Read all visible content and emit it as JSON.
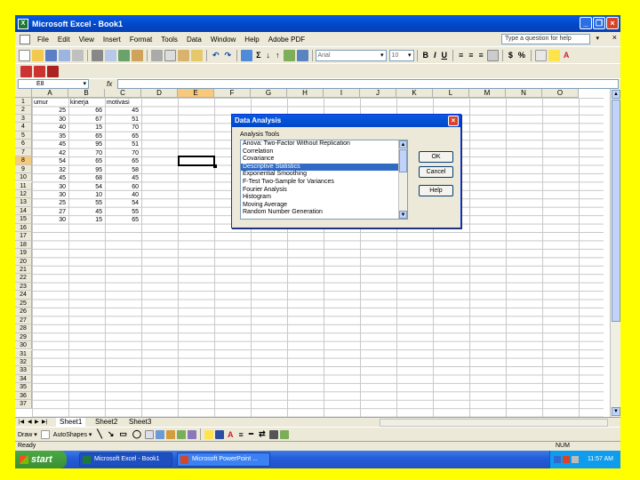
{
  "window": {
    "title": "Microsoft Excel - Book1",
    "app_icon": "X"
  },
  "menubar": {
    "items": [
      "File",
      "Edit",
      "View",
      "Insert",
      "Format",
      "Tools",
      "Data",
      "Window",
      "Help",
      "Adobe PDF"
    ],
    "help_placeholder": "Type a question for help",
    "doc_close": "× "
  },
  "toolbar": {
    "font_name": "Arial",
    "font_size": "10",
    "bold": "B",
    "italic": "I",
    "underline": "U",
    "currency": "$",
    "percent": "%"
  },
  "formula_bar": {
    "name_box": "E8",
    "fx": "fx"
  },
  "grid": {
    "columns": [
      "A",
      "B",
      "C",
      "D",
      "E",
      "F",
      "G",
      "H",
      "I",
      "J",
      "K",
      "L",
      "M",
      "N",
      "O"
    ],
    "rows": [
      "1",
      "2",
      "3",
      "4",
      "5",
      "6",
      "7",
      "8",
      "9",
      "10",
      "11",
      "12",
      "13",
      "14",
      "15",
      "16",
      "17",
      "18",
      "19",
      "20",
      "21",
      "22",
      "23",
      "24",
      "25",
      "26",
      "27",
      "28",
      "29",
      "30",
      "31",
      "32",
      "33",
      "34",
      "35",
      "36",
      "37"
    ],
    "active_cell": "E8",
    "headers": [
      "umur",
      "kinerja",
      "motivasi"
    ],
    "data": [
      [
        "25",
        "66",
        "45"
      ],
      [
        "30",
        "67",
        "51"
      ],
      [
        "40",
        "15",
        "70"
      ],
      [
        "35",
        "65",
        "65"
      ],
      [
        "45",
        "95",
        "51"
      ],
      [
        "42",
        "70",
        "70"
      ],
      [
        "54",
        "65",
        "65"
      ],
      [
        "32",
        "95",
        "58"
      ],
      [
        "45",
        "68",
        "45"
      ],
      [
        "30",
        "54",
        "60"
      ],
      [
        "30",
        "10",
        "40"
      ],
      [
        "25",
        "55",
        "54"
      ],
      [
        "27",
        "45",
        "55"
      ],
      [
        "30",
        "15",
        "65"
      ]
    ]
  },
  "sheets": {
    "tabs": [
      "Sheet1",
      "Sheet2",
      "Sheet3"
    ],
    "active": "Sheet1"
  },
  "drawbar": {
    "draw_label": "Draw ▾",
    "autoshapes_label": "AutoShapes ▾"
  },
  "status": {
    "left": "Ready",
    "num": "NUM"
  },
  "taskbar": {
    "start": "start",
    "items": [
      "Microsoft Excel - Book1",
      "Microsoft PowerPoint ..."
    ],
    "clock": "11:57 AM"
  },
  "dialog": {
    "title": "Data Analysis",
    "tools_label": "Analysis Tools",
    "tools": [
      "Anova: Two-Factor Without Replication",
      "Correlation",
      "Covariance",
      "Descriptive Statistics",
      "Exponential Smoothing",
      "F-Test Two-Sample for Variances",
      "Fourier Analysis",
      "Histogram",
      "Moving Average",
      "Random Number Generation"
    ],
    "selected_tool": "Descriptive Statistics",
    "ok": "OK",
    "cancel": "Cancel",
    "help": "Help"
  }
}
